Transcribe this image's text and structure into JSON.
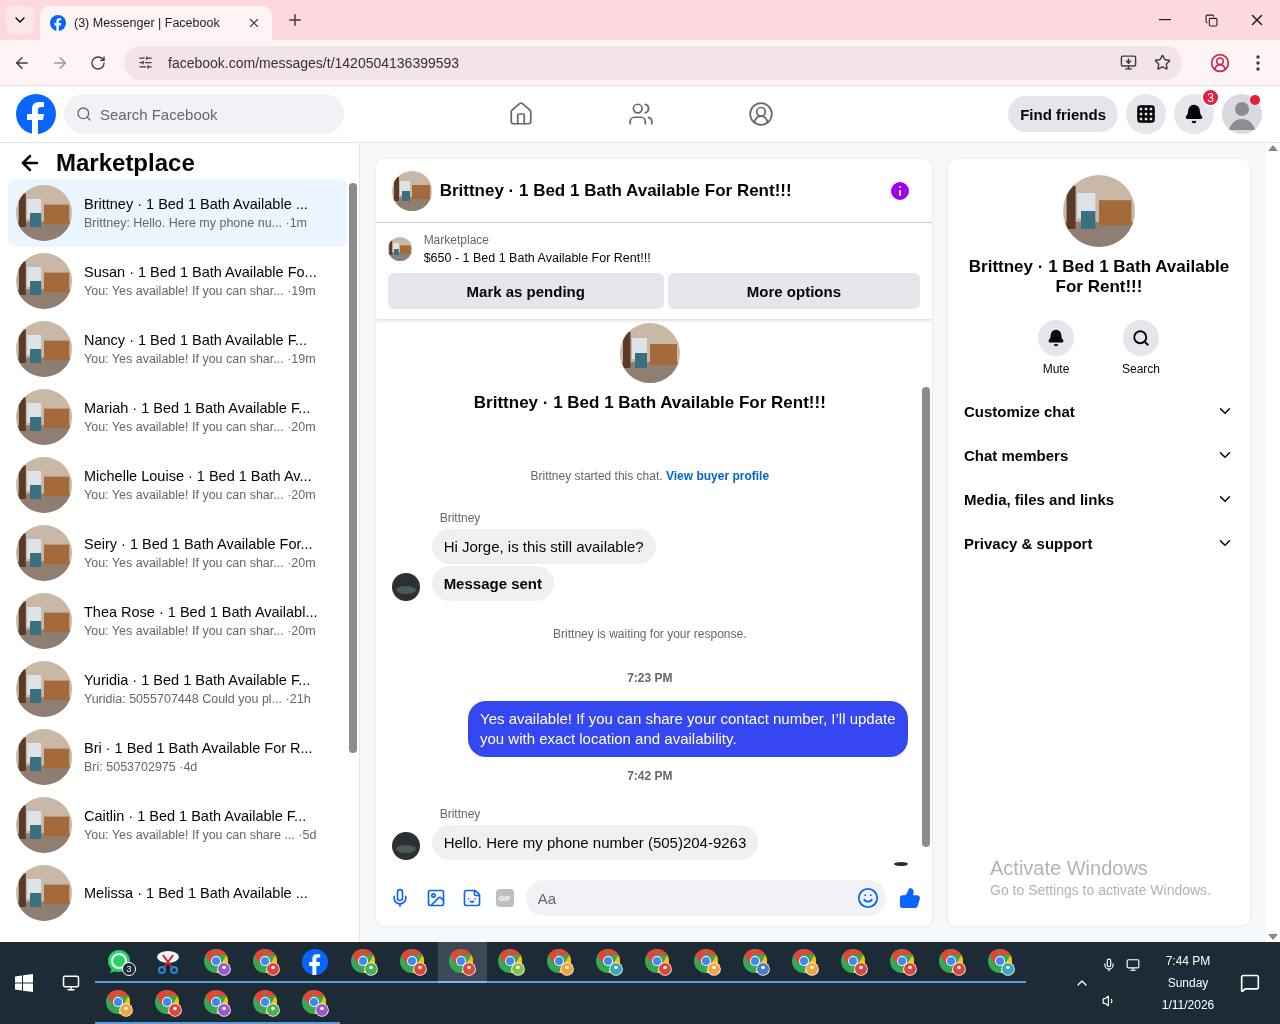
{
  "browser": {
    "tab_title": "(3) Messenger | Facebook",
    "url": "facebook.com/messages/t/1420504136399593"
  },
  "header": {
    "search_placeholder": "Search Facebook",
    "find_friends": "Find friends",
    "notification_count": "3"
  },
  "sidebar": {
    "title": "Marketplace",
    "conversations": [
      {
        "name": "Brittney · 1 Bed 1 Bath Available ...",
        "preview": "Brittney: Hello. Here my phone nu...",
        "time": "·1m",
        "selected": true
      },
      {
        "name": "Susan · 1 Bed 1 Bath Available Fo...",
        "preview": "You: Yes available! If you can shar...",
        "time": "·19m",
        "selected": false
      },
      {
        "name": "Nancy · 1 Bed 1 Bath Available F...",
        "preview": "You: Yes available! If you can shar...",
        "time": "·19m",
        "selected": false
      },
      {
        "name": "Mariah · 1 Bed 1 Bath Available F...",
        "preview": "You: Yes available! If you can shar...",
        "time": "·20m",
        "selected": false
      },
      {
        "name": "Michelle Louise · 1 Bed 1 Bath Av...",
        "preview": "You: Yes available! If you can shar...",
        "time": "·20m",
        "selected": false
      },
      {
        "name": "Seiry · 1 Bed 1 Bath Available For...",
        "preview": "You: Yes available! If you can shar...",
        "time": "·20m",
        "selected": false
      },
      {
        "name": "Thea Rose · 1 Bed 1 Bath Availabl...",
        "preview": "You: Yes available! If you can shar...",
        "time": "·20m",
        "selected": false
      },
      {
        "name": "Yuridia · 1 Bed 1 Bath Available F...",
        "preview": "Yuridia: 5055707448 Could you pl...",
        "time": "·21h",
        "selected": false
      },
      {
        "name": "Bri · 1 Bed 1 Bath Available For R...",
        "preview": "Bri: 5053702975",
        "time": "·4d",
        "selected": false
      },
      {
        "name": "Caitlin · 1 Bed 1 Bath Available F...",
        "preview": "You: Yes available! If you can share ...",
        "time": "·5d",
        "selected": false
      },
      {
        "name": "Melissa · 1 Bed 1 Bath Available ...",
        "selected": false
      }
    ]
  },
  "chat": {
    "title": "Brittney · 1 Bed 1 Bath Available For Rent!!!",
    "listing": {
      "label": "Marketplace",
      "text": "$650 - 1 Bed 1 Bath Available For Rent!!!"
    },
    "actions": [
      "Mark as pending",
      "More options"
    ],
    "intro_title": "Brittney · 1 Bed 1 Bath Available For Rent!!!",
    "started": {
      "text": "Brittney started this chat.",
      "link": "View buyer profile"
    },
    "messages": [
      {
        "kind": "sender",
        "text": "Brittney"
      },
      {
        "kind": "incoming",
        "text": "Hi Jorge, is this still available?",
        "avatar": false,
        "bold": false
      },
      {
        "kind": "incoming",
        "text": "Message sent",
        "avatar": true,
        "bold": true
      },
      {
        "kind": "system",
        "text": "Brittney is waiting for your response."
      },
      {
        "kind": "time",
        "text": "7:23 PM"
      },
      {
        "kind": "outgoing",
        "text": "Yes available! If you can share your contact number, I’ll update you with exact location and availability."
      },
      {
        "kind": "time",
        "text": "7:42 PM"
      },
      {
        "kind": "sender",
        "text": "Brittney"
      },
      {
        "kind": "incoming",
        "text": "Hello. Here my phone number (505)204-9263",
        "avatar": true,
        "bold": false
      }
    ],
    "composer": {
      "placeholder": "Aa",
      "gif": "GIF"
    }
  },
  "details": {
    "title": "Brittney · 1 Bed 1 Bath Available For Rent!!!",
    "actions": [
      {
        "kind": "mute",
        "label": "Mute"
      },
      {
        "kind": "search",
        "label": "Search"
      }
    ],
    "sections": [
      {
        "label": "Customize chat",
        "expanded": false
      },
      {
        "label": "Chat members",
        "expanded": false
      },
      {
        "label": "Media, files and links",
        "expanded": false
      },
      {
        "label": "Privacy & support",
        "expanded": false
      }
    ]
  },
  "activation_notice": {
    "title": "Activate Windows",
    "text": "Go to Settings to activate Windows."
  },
  "taskbar": {
    "apps": [
      {
        "kind": "whatsapp",
        "badge": "3",
        "selected": false
      },
      {
        "kind": "app",
        "selected": false
      },
      {
        "kind": "chrome",
        "color": "#9b59d0",
        "selected": false
      },
      {
        "kind": "chrome",
        "color": "#e0443c",
        "selected": false
      },
      {
        "kind": "facebook",
        "selected": false
      },
      {
        "kind": "chrome",
        "color": "#4caf50",
        "selected": false
      },
      {
        "kind": "chrome",
        "color": "#e0443c",
        "selected": false
      },
      {
        "kind": "chrome",
        "color": "#e0443c",
        "selected": true
      },
      {
        "kind": "chrome",
        "color": "#8bc34a",
        "selected": false
      },
      {
        "kind": "chrome",
        "color": "#f4a340",
        "selected": false
      },
      {
        "kind": "chrome",
        "color": "#3aa6b9",
        "selected": false
      },
      {
        "kind": "chrome",
        "color": "#e0443c",
        "selected": false
      },
      {
        "kind": "chrome",
        "color": "#f4a340",
        "selected": false
      },
      {
        "kind": "chrome",
        "color": "#4a7bd0",
        "selected": false
      },
      {
        "kind": "chrome",
        "color": "#f4a340",
        "selected": false
      },
      {
        "kind": "chrome",
        "color": "#e0443c",
        "selected": false
      },
      {
        "kind": "chrome",
        "color": "#e0443c",
        "selected": false
      },
      {
        "kind": "chrome",
        "color": "#e0443c",
        "selected": false
      },
      {
        "kind": "chrome",
        "color": "#3aa6b9",
        "selected": false
      },
      {
        "kind": "chrome",
        "color": "#f4a340",
        "selected": false
      },
      {
        "kind": "chrome",
        "color": "#e0443c",
        "selected": false
      },
      {
        "kind": "chrome",
        "color": "#9b59d0",
        "selected": false
      },
      {
        "kind": "chrome",
        "color": "#4caf50",
        "selected": false
      },
      {
        "kind": "chrome",
        "color": "#9b59d0",
        "selected": false
      }
    ],
    "clock": {
      "time": "7:44 PM",
      "day": "Sunday",
      "date": "1/11/2026"
    }
  }
}
